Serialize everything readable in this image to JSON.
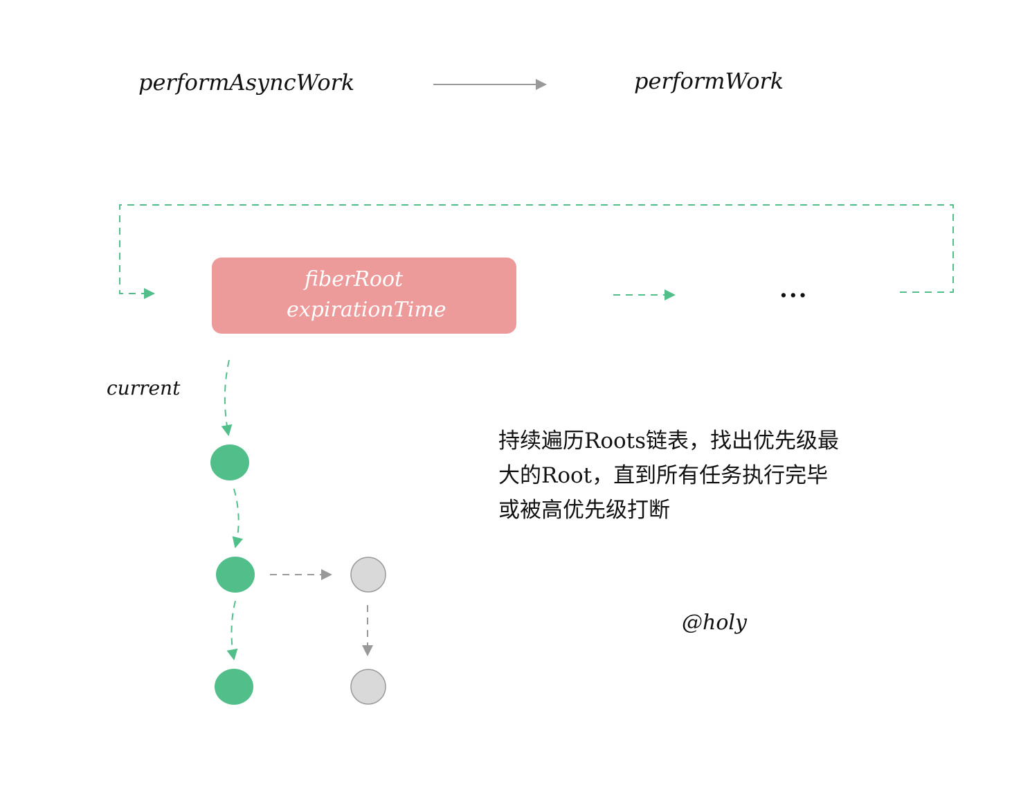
{
  "labels": {
    "perform_async_work": "performAsyncWork",
    "perform_work": "performWork",
    "current": "current",
    "ellipsis": "...",
    "author": "@holy"
  },
  "fiber_root": {
    "line1": "fiberRoot",
    "line2": "expirationTime"
  },
  "description": {
    "line1": "持续遍历Roots链表，找出优先级最",
    "line2": "大的Root，直到所有任务执行完毕",
    "line3": "或被高优先级打断"
  },
  "colors": {
    "green": "#52bf8a",
    "gray_node": "#d9d9d9",
    "gray_node_border": "#999999",
    "gray_arrow": "#999999",
    "fiber_box": "#ed9a9b",
    "text": "#111111"
  }
}
